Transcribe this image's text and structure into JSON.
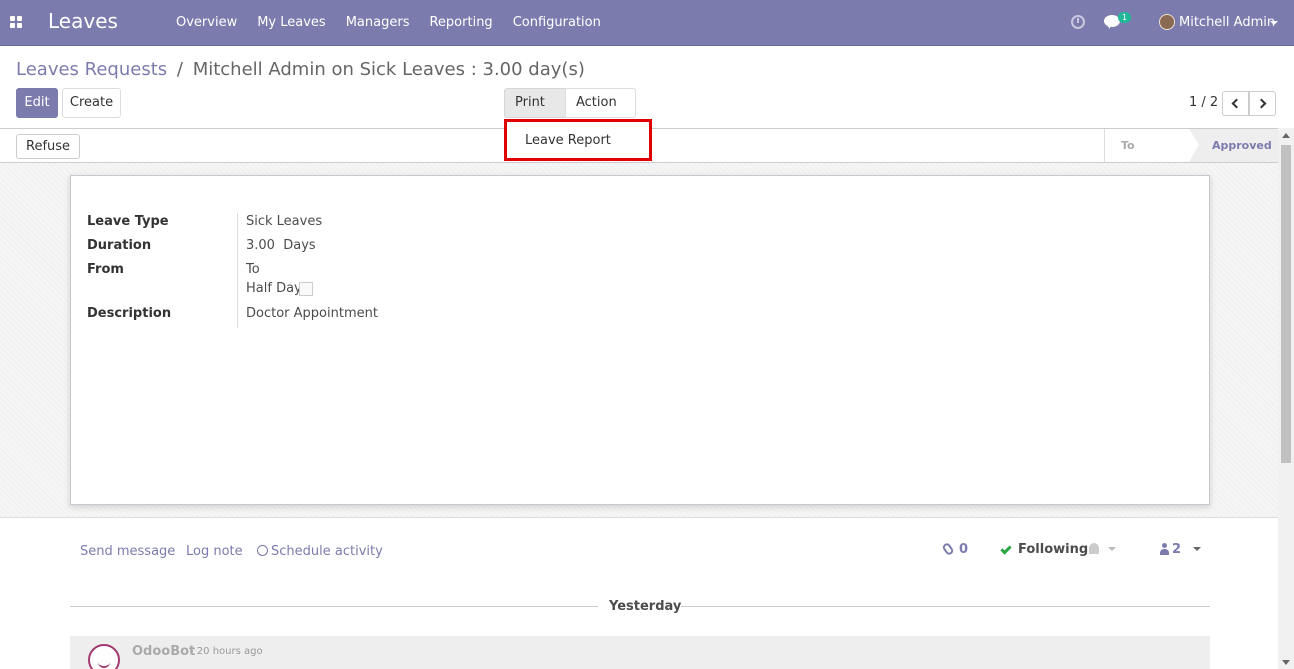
{
  "navbar": {
    "app_title": "Leaves",
    "menu": [
      "Overview",
      "My Leaves",
      "Managers",
      "Reporting",
      "Configuration"
    ],
    "chat_count": "1",
    "user_name": "Mitchell Admin"
  },
  "breadcrumb": {
    "parent": "Leaves Requests",
    "separator": "/",
    "current": "Mitchell Admin on Sick Leaves : 3.00 day(s)"
  },
  "buttons": {
    "edit": "Edit",
    "create": "Create",
    "print": "Print",
    "action": "Action"
  },
  "print_dropdown": {
    "items": [
      "Leave Report"
    ]
  },
  "pager": {
    "value": "1 / 2"
  },
  "statusbar": {
    "refuse": "Refuse",
    "stages": [
      "To Approve",
      "Approved"
    ],
    "active_stage": "Approved"
  },
  "form": {
    "leave_type_label": "Leave Type",
    "leave_type_value": "Sick Leaves",
    "duration_label": "Duration",
    "duration_value": "3.00",
    "duration_unit": "Days",
    "from_label": "From",
    "to_label": "To",
    "half_day_label": "Half Day",
    "half_day_checked": false,
    "description_label": "Description",
    "description_value": "Doctor Appointment"
  },
  "chatter": {
    "send_message": "Send message",
    "log_note": "Log note",
    "schedule_activity": "Schedule activity",
    "attachments_count": "0",
    "following": "Following",
    "followers_count": "2",
    "date_separator": "Yesterday",
    "message_author": "OdooBot",
    "message_time": "- 20 hours ago"
  },
  "colors": {
    "brand": "#7c7bad",
    "highlight_border": "#e00000",
    "following_check": "#28a745",
    "badge": "#21b799"
  }
}
